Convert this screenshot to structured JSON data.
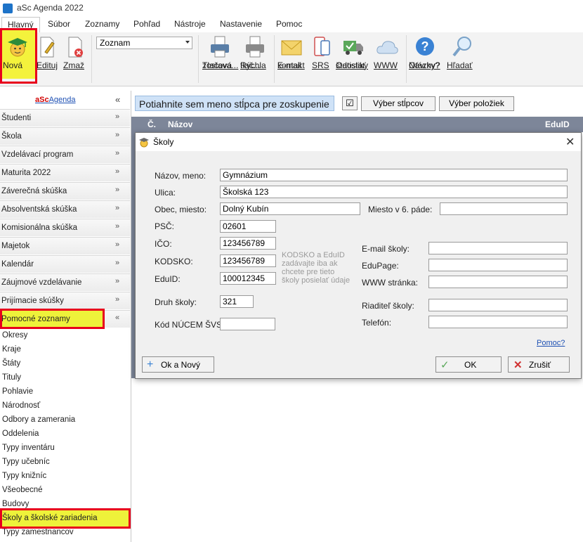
{
  "window": {
    "title": "aSc Agenda 2022"
  },
  "menu": {
    "tabs": [
      "Hlavný",
      "Súbor",
      "Zoznamy",
      "Pohľad",
      "Nástroje",
      "Nastavenie",
      "Pomoc"
    ]
  },
  "ribbon": {
    "nova": "Nová",
    "edituj": "Edituj",
    "zmaz": "Zmaž",
    "view_select": "Zoznam",
    "print_l1": "Tlačová",
    "print_l2": "zostava...",
    "quickprint_l1": "Rýchla",
    "quickprint_l2": "tlač...",
    "email_l1": "E-mail",
    "email_l2": "kontakt",
    "srs": "SRS",
    "stats_l1": "Odoslať",
    "stats_l2": "štatistiky",
    "www": "WWW",
    "questions_l1": "Otázky?",
    "questions_l2": "Návrhy?",
    "search": "Hľadať"
  },
  "sidebar": {
    "brand_prefix": "aSc",
    "brand_suffix": "Agenda",
    "sections": [
      "Študenti",
      "Škola",
      "Vzdelávací program",
      "Maturita 2022",
      "Záverečná skúška",
      "Absolventská skúška",
      "Komisionálna skúška",
      "Majetok",
      "Kalendár",
      "Záujmové vzdelávanie",
      "Prijímacie skúšky",
      "Pomocné zoznamy"
    ],
    "items": [
      "Okresy",
      "Kraje",
      "Štáty",
      "Tituly",
      "Pohlavie",
      "Národnosť",
      "Odbory a zamerania",
      "Oddelenia",
      "Typy inventáru",
      "Typy učebníc",
      "Typy knižníc",
      "Všeobecné",
      "Budovy",
      "Školy a školské zariadenia",
      "Typy zamestnancov"
    ]
  },
  "grid": {
    "group_hint": "Potiahnite sem meno stĺpca pre zoskupenie",
    "checkbox_glyph": "☑",
    "select_columns": "Výber stĺpcov",
    "select_items": "Výber položiek",
    "columns": [
      "Č.",
      "Názov",
      "EduID"
    ]
  },
  "dialog": {
    "title": "Školy",
    "close_glyph": "✕",
    "labels": {
      "name": "Názov, meno:",
      "street": "Ulica:",
      "city": "Obec, miesto:",
      "city6": "Miesto v 6. páde:",
      "psc": "PSČ:",
      "ico": "IČO:",
      "kodsko": "KODSKO:",
      "eduid": "EduID:",
      "type": "Druh školy:",
      "nucem": "Kód NÚCEM ŠVS:",
      "email": "E-mail školy:",
      "edupage": "EduPage:",
      "www": "WWW stránka:",
      "director": "Riaditeľ školy:",
      "phone": "Telefón:"
    },
    "values": {
      "name": "Gymnázium",
      "street": "Školská 123",
      "city": "Dolný Kubín",
      "city6": "",
      "psc": "02601",
      "ico": "123456789",
      "kodsko": "123456789",
      "eduid": "100012345",
      "type": "321",
      "nucem": "",
      "email": "",
      "edupage": "",
      "www": "",
      "director": "",
      "phone": ""
    },
    "hint_lines": [
      "KODSKO a EduID",
      "zadávajte iba ak",
      "chcete pre tieto",
      "školy posielať údaje"
    ],
    "help_link": "Pomoc?",
    "ok_new": "Ok a Nový",
    "ok": "OK",
    "cancel": "Zrušiť"
  },
  "colors": {
    "highlight_border": "#e8001c",
    "highlight_fill": "#eef23a",
    "accent_blue": "#1e73c8"
  }
}
